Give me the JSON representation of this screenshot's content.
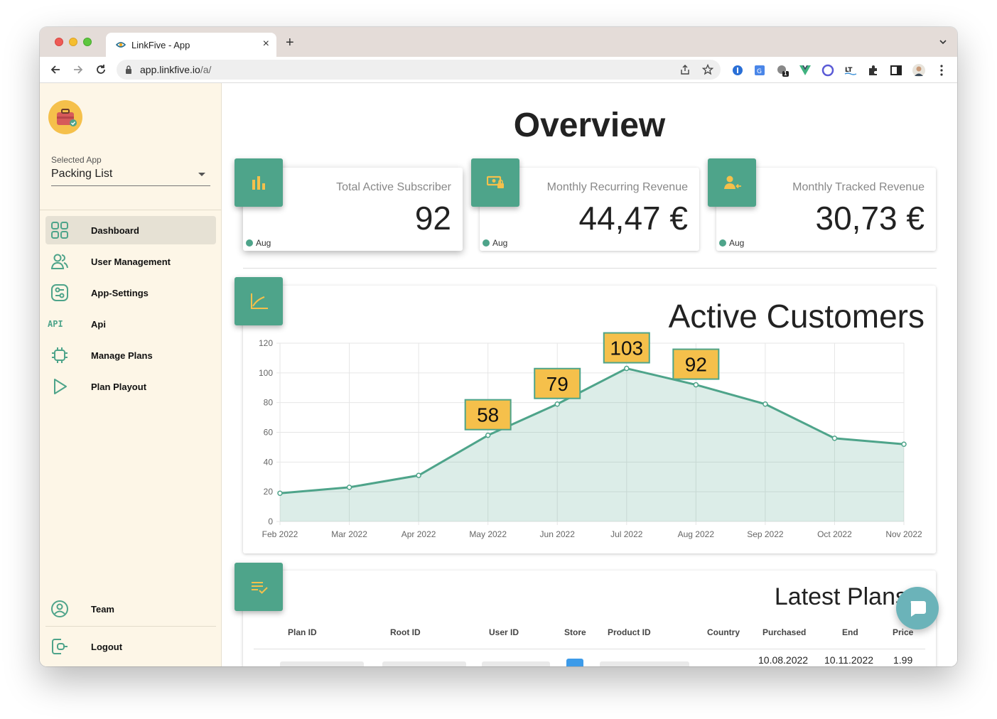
{
  "browser": {
    "tab_title": "LinkFive - App",
    "url_host": "app.linkfive.io",
    "url_path": "/a/",
    "ext_badge_count": "1"
  },
  "sidebar": {
    "selected_app_label": "Selected App",
    "selected_app_value": "Packing List",
    "items": [
      {
        "label": "Dashboard",
        "icon": "dashboard-icon",
        "active": true
      },
      {
        "label": "User Management",
        "icon": "users-icon"
      },
      {
        "label": "App-Settings",
        "icon": "settings-icon"
      },
      {
        "label": "Api",
        "icon": "api-icon"
      },
      {
        "label": "Manage Plans",
        "icon": "chip-icon"
      },
      {
        "label": "Plan Playout",
        "icon": "play-icon"
      }
    ],
    "team_label": "Team",
    "logout_label": "Logout",
    "api_icon_text": "API"
  },
  "main": {
    "title": "Overview",
    "stats": [
      {
        "title": "Total Active Subscriber",
        "value": "92",
        "footer": "Aug",
        "icon": "bar-chart-icon"
      },
      {
        "title": "Monthly Recurring Revenue",
        "value": "44,47 €",
        "footer": "Aug",
        "icon": "money-lock-icon"
      },
      {
        "title": "Monthly Tracked Revenue",
        "value": "30,73 €",
        "footer": "Aug",
        "icon": "person-arrow-icon"
      }
    ],
    "latest_plans": {
      "title": "Latest Plans",
      "columns": [
        "Plan ID",
        "Root ID",
        "User ID",
        "Store",
        "Product ID",
        "Country",
        "Purchased",
        "End",
        "Price"
      ],
      "row": {
        "purchased": "10.08.2022",
        "end": "10.11.2022",
        "price": "1.99"
      }
    }
  },
  "colors": {
    "accent": "#4ea48a",
    "sidebar_bg": "#fdf6e7",
    "highlight": "#f5c04b",
    "fab": "#6bb3b9"
  },
  "chart_data": {
    "type": "area",
    "title": "Active Customers",
    "x": [
      "Feb 2022",
      "Mar 2022",
      "Apr 2022",
      "May 2022",
      "Jun 2022",
      "Jul 2022",
      "Aug 2022",
      "Sep 2022",
      "Oct 2022",
      "Nov 2022"
    ],
    "series": [
      {
        "values": [
          19,
          23,
          31,
          58,
          79,
          103,
          92,
          79,
          56,
          52
        ]
      }
    ],
    "annotations": [
      {
        "x": "May 2022",
        "label": "58"
      },
      {
        "x": "Jun 2022",
        "label": "79"
      },
      {
        "x": "Jul 2022",
        "label": "103"
      },
      {
        "x": "Aug 2022",
        "label": "92"
      }
    ],
    "ylim": [
      0,
      120
    ],
    "yticks": [
      0,
      20,
      40,
      60,
      80,
      100,
      120
    ],
    "grid": true
  }
}
